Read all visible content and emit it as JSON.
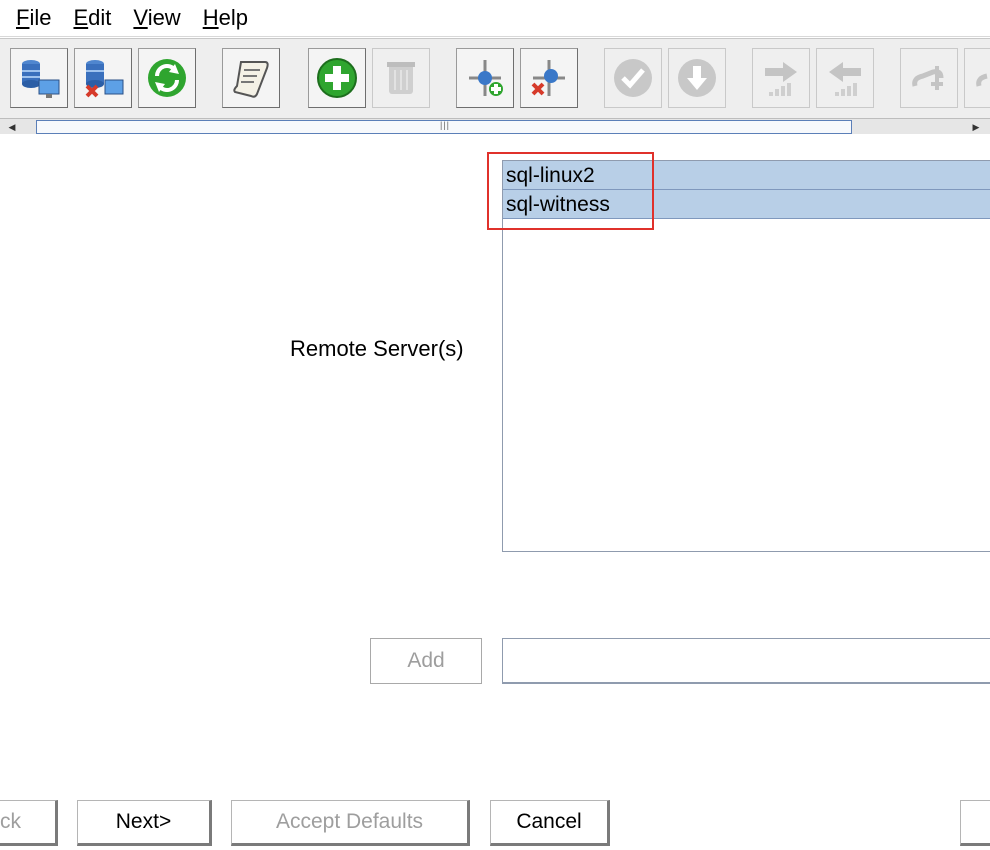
{
  "menu": [
    {
      "mnemonic": "F",
      "rest": "ile"
    },
    {
      "mnemonic": "E",
      "rest": "dit"
    },
    {
      "mnemonic": "V",
      "rest": "iew"
    },
    {
      "mnemonic": "H",
      "rest": "elp"
    }
  ],
  "toolbar": {
    "buttons": [
      {
        "name": "connect-server-icon",
        "enabled": true
      },
      {
        "name": "disconnect-server-icon",
        "enabled": true
      },
      {
        "name": "refresh-icon",
        "enabled": true
      },
      {
        "name": "script-scroll-icon",
        "enabled": true
      },
      {
        "name": "create-resource-icon",
        "enabled": true
      },
      {
        "name": "delete-resource-icon",
        "enabled": false
      },
      {
        "name": "extend-hierarchy-icon",
        "enabled": true
      },
      {
        "name": "unextend-hierarchy-icon",
        "enabled": true
      },
      {
        "name": "in-service-icon",
        "enabled": false
      },
      {
        "name": "out-of-service-icon",
        "enabled": false
      },
      {
        "name": "switchover-forward-icon",
        "enabled": false
      },
      {
        "name": "switchover-back-icon",
        "enabled": false
      },
      {
        "name": "link-icon",
        "enabled": false
      },
      {
        "name": "unlink-icon",
        "enabled": false
      }
    ],
    "colors": {
      "green": "#2fa52f",
      "red": "#d63a2a",
      "blue": "#3a78c8",
      "gray": "#b8b8b8"
    }
  },
  "scrollbar": {
    "grip": "|||"
  },
  "form": {
    "remote_label": "Remote Server(s)",
    "servers": [
      "sql-linux2",
      "sql-witness"
    ],
    "add_label": "Add",
    "add_value": "",
    "highlight_color": "#e0312b",
    "selection_color": "#b8cfe7"
  },
  "buttons": {
    "back": "< Back",
    "next": "Next>",
    "accept": "Accept Defaults",
    "cancel": "Cancel",
    "edge": ""
  }
}
